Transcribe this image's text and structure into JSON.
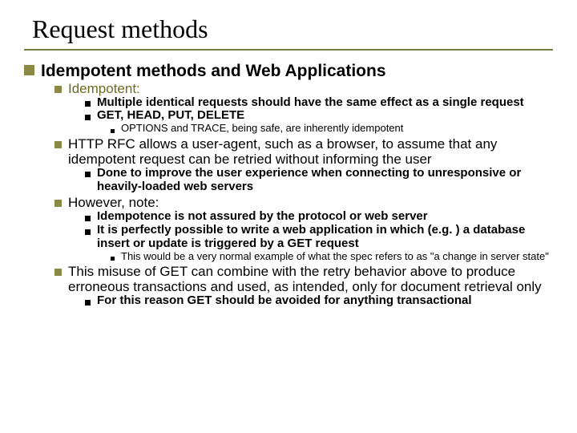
{
  "title": "Request methods",
  "b1": "Idempotent methods and Web Applications",
  "b1_1": "Idempotent:",
  "b1_1_1": "Multiple identical requests should have the same effect as a single request",
  "b1_1_2": "GET, HEAD, PUT, DELETE",
  "b1_1_2_1": "OPTIONS and TRACE, being safe, are inherently idempotent",
  "b1_2": "HTTP RFC allows a user-agent, such as a browser, to assume that any idempotent request can be retried without informing the user",
  "b1_2_1": "Done to improve the user experience when connecting to unresponsive or heavily-loaded web servers",
  "b1_3": "However, note:",
  "b1_3_1": "Idempotence is not assured by the protocol or web server",
  "b1_3_2": "It is perfectly possible to write a web application in which (e.g. ) a database insert or update is triggered by a GET request",
  "b1_3_2_1": "This would be a very normal example of what the spec refers to as \"a change in server state\"",
  "b1_4": "This misuse of GET can combine with the retry behavior above to produce erroneous transactions and used, as intended, only for document retrieval only",
  "b1_4_1": "For this reason GET should be avoided for anything transactional"
}
